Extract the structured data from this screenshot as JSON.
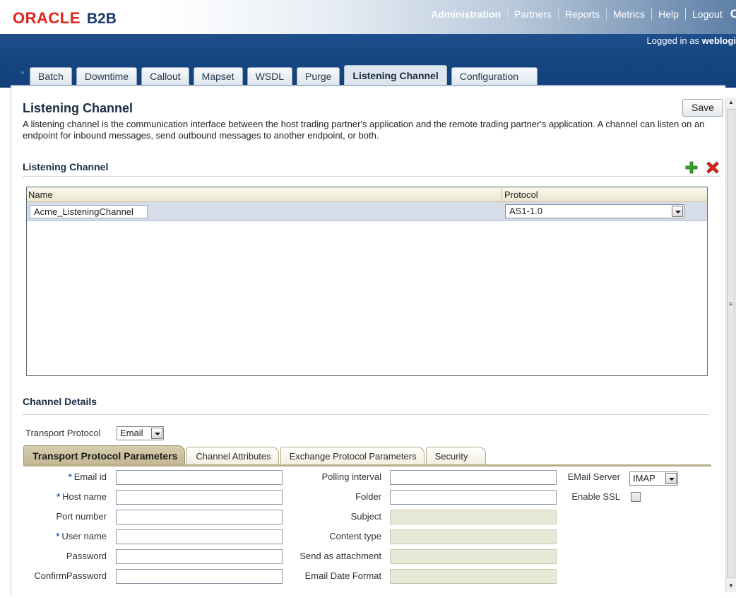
{
  "header": {
    "brand_oracle": "ORACLE",
    "brand_product": "B2B",
    "nav": [
      "Administration",
      "Partners",
      "Reports",
      "Metrics",
      "Help",
      "Logout"
    ],
    "logged_prefix": "Logged in as ",
    "logged_user": "weblogi"
  },
  "tabs": [
    "Batch",
    "Downtime",
    "Callout",
    "Mapset",
    "WSDL",
    "Purge",
    "Listening Channel",
    "Configuration"
  ],
  "page": {
    "title": "Listening Channel",
    "save_label": "Save",
    "description": "A listening channel is the communication interface between the host trading partner's application and the remote trading partner's application. A channel can listen on an endpoint for inbound messages, send outbound messages to another endpoint, or both."
  },
  "listening_section": {
    "heading": "Listening Channel",
    "columns": [
      "Name",
      "Protocol"
    ],
    "rows": [
      {
        "name": "Acme_ListeningChannel",
        "protocol": "AS1-1.0"
      }
    ]
  },
  "details": {
    "heading": "Channel Details",
    "transport_protocol_label": "Transport Protocol",
    "transport_protocol_value": "Email",
    "subtabs": [
      "Transport Protocol Parameters",
      "Channel Attributes",
      "Exchange Protocol Parameters",
      "Security"
    ],
    "left_fields": [
      {
        "label": "Email id",
        "required": true
      },
      {
        "label": "Host name",
        "required": true
      },
      {
        "label": "Port number",
        "required": false
      },
      {
        "label": "User name",
        "required": true
      },
      {
        "label": "Password",
        "required": false
      },
      {
        "label": "ConfirmPassword",
        "required": false
      }
    ],
    "mid_fields": [
      {
        "label": "Polling interval",
        "disabled": false
      },
      {
        "label": "Folder",
        "disabled": false
      },
      {
        "label": "Subject",
        "disabled": true
      },
      {
        "label": "Content type",
        "disabled": true
      },
      {
        "label": "Send as attachment",
        "disabled": true
      },
      {
        "label": "Email Date Format",
        "disabled": true
      }
    ],
    "email_server_label": "EMail Server",
    "email_server_value": "IMAP",
    "enable_ssl_label": "Enable SSL",
    "required_marker": "*"
  }
}
